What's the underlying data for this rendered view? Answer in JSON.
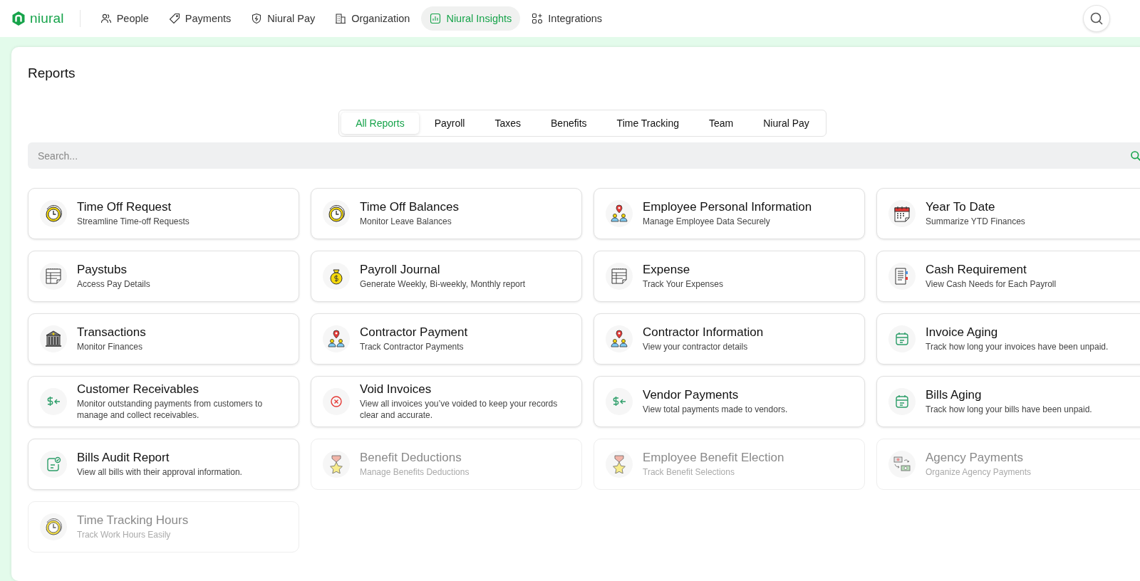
{
  "brand": {
    "name": "niural"
  },
  "nav": [
    {
      "label": "People",
      "kind": "people",
      "selected": false
    },
    {
      "label": "Payments",
      "kind": "tag",
      "selected": false
    },
    {
      "label": "Niural Pay",
      "kind": "shield",
      "selected": false
    },
    {
      "label": "Organization",
      "kind": "building",
      "selected": false
    },
    {
      "label": "Niural Insights",
      "kind": "chart",
      "selected": true
    },
    {
      "label": "Integrations",
      "kind": "grid",
      "selected": false
    }
  ],
  "page": {
    "title": "Reports"
  },
  "tabs": [
    {
      "label": "All Reports",
      "selected": true
    },
    {
      "label": "Payroll",
      "selected": false
    },
    {
      "label": "Taxes",
      "selected": false
    },
    {
      "label": "Benefits",
      "selected": false
    },
    {
      "label": "Time Tracking",
      "selected": false
    },
    {
      "label": "Team",
      "selected": false
    },
    {
      "label": "Niural Pay",
      "selected": false
    }
  ],
  "search": {
    "placeholder": "Search..."
  },
  "reports": [
    {
      "title": "Time Off Request",
      "subtitle": "Streamline Time-off Requests",
      "kind": "clock",
      "disabled": false
    },
    {
      "title": "Time Off Balances",
      "subtitle": "Monitor Leave Balances",
      "kind": "clock",
      "disabled": false
    },
    {
      "title": "Employee Personal Information",
      "subtitle": "Manage Employee Data Securely",
      "kind": "pin-people",
      "disabled": false
    },
    {
      "title": "Year To Date",
      "subtitle": "Summarize YTD Finances",
      "kind": "calendar",
      "disabled": false
    },
    {
      "title": "Paystubs",
      "subtitle": "Access Pay Details",
      "kind": "sheet",
      "disabled": false
    },
    {
      "title": "Payroll Journal",
      "subtitle": "Generate Weekly, Bi-weekly, Monthly report",
      "kind": "moneybag",
      "disabled": false
    },
    {
      "title": "Expense",
      "subtitle": "Track Your Expenses",
      "kind": "sheet",
      "disabled": false
    },
    {
      "title": "Cash Requirement",
      "subtitle": "View Cash Needs for Each Payroll",
      "kind": "document",
      "disabled": false
    },
    {
      "title": "Transactions",
      "subtitle": "Monitor Finances",
      "kind": "bank",
      "disabled": false
    },
    {
      "title": "Contractor Payment",
      "subtitle": "Track Contractor Payments",
      "kind": "pin-people",
      "disabled": false
    },
    {
      "title": "Contractor Information",
      "subtitle": "View your contractor details",
      "kind": "pin-people",
      "disabled": false
    },
    {
      "title": "Invoice Aging",
      "subtitle": "Track how long your invoices have been unpaid.",
      "kind": "green-calendar",
      "disabled": false
    },
    {
      "title": "Customer Receivables",
      "subtitle": "Monitor outstanding payments from customers to manage and collect receivables.",
      "kind": "dollar-arrow",
      "disabled": false
    },
    {
      "title": "Void Invoices",
      "subtitle": "View all invoices you’ve voided to keep your records clear and accurate.",
      "kind": "void",
      "disabled": false
    },
    {
      "title": "Vendor Payments",
      "subtitle": "View total payments made to vendors.",
      "kind": "dollar-arrow",
      "disabled": false
    },
    {
      "title": "Bills Aging",
      "subtitle": "Track how long your bills have been unpaid.",
      "kind": "green-calendar",
      "disabled": false
    },
    {
      "title": "Bills Audit Report",
      "subtitle": "View all bills with their approval information.",
      "kind": "bill-check",
      "disabled": false
    },
    {
      "title": "Benefit Deductions",
      "subtitle": "Manage Benefits Deductions",
      "kind": "medal",
      "disabled": true
    },
    {
      "title": "Employee Benefit Election",
      "subtitle": "Track Benefit Selections",
      "kind": "medal",
      "disabled": true
    },
    {
      "title": "Agency Payments",
      "subtitle": "Organize Agency Payments",
      "kind": "exchange",
      "disabled": true
    },
    {
      "title": "Time Tracking Hours",
      "subtitle": "Track Work Hours Easily",
      "kind": "clock",
      "disabled": true
    }
  ]
}
